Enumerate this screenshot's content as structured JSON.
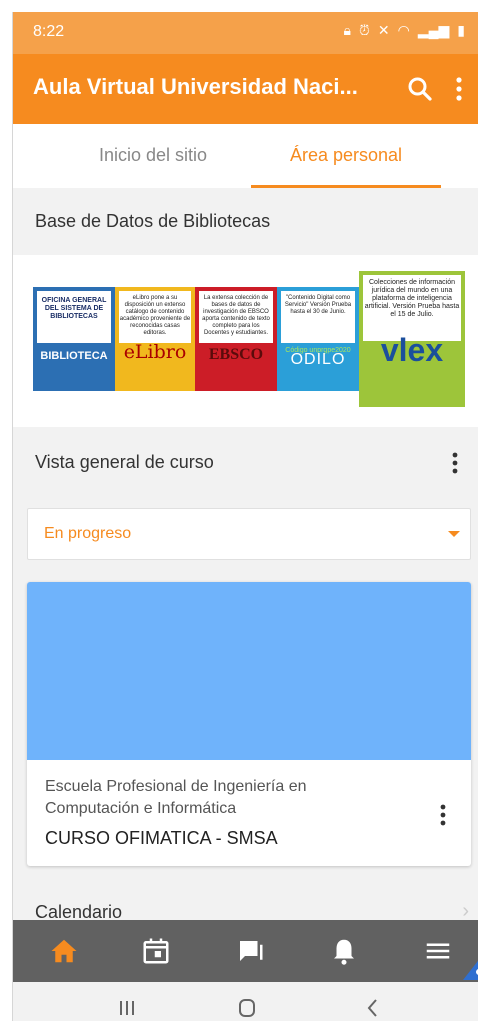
{
  "status_bar": {
    "time": "8:22",
    "icons": [
      "lock-icon",
      "alarm-icon",
      "mute-icon",
      "wifi-icon",
      "signal-icon",
      "battery-icon"
    ]
  },
  "app_bar": {
    "title": "Aula Virtual Universidad Naci..."
  },
  "tabs": [
    {
      "label": "Inicio del sitio",
      "active": false
    },
    {
      "label": "Área personal",
      "active": true
    }
  ],
  "blocks": {
    "title": "Base de Datos de Bibliotecas",
    "libraries": [
      {
        "top_text": "OFICINA GENERAL DEL SISTEMA DE BIBLIOTECAS",
        "logo": "BIBLIOTECA"
      },
      {
        "top_text": "eLibro pone a su disposición un extenso catálogo de contenido académico proveniente de reconocidas casas editoras.",
        "logo": "eLibro"
      },
      {
        "top_text": "La extensa colección de bases de datos de investigación de EBSCO aporta contenido de texto completo para los Docentes y estudiantes.",
        "logo": "EBSCO"
      },
      {
        "top_text": "\"Contenido Digital como Servicio\" Versión Prueba hasta el 30 de Junio.",
        "code": "Código unprgpe2020",
        "logo": "ODILO"
      },
      {
        "top_text": "Colecciones de información jurídica del mundo en una plataforma de inteligencia artificial. Versión Prueba hasta el 15 de Julio.",
        "logo": "vlex"
      }
    ]
  },
  "overview": {
    "title": "Vista general de curso",
    "filter": "En progreso",
    "course": {
      "category": "Escuela Profesional de Ingeniería en Computación e Informática",
      "name": "CURSO OFIMATICA - SMSA",
      "image_color": "#6fb3fb"
    }
  },
  "calendar": {
    "label": "Calendario"
  },
  "colors": {
    "accent": "#f68b1f",
    "nav_bg": "#616161"
  }
}
